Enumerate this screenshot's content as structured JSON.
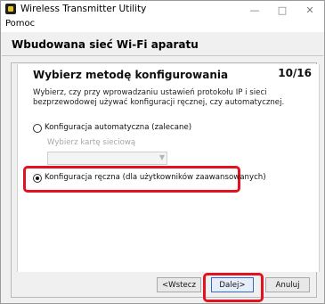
{
  "window": {
    "title": "Wireless Transmitter Utility"
  },
  "titlebar_controls": {
    "minimize": "—",
    "maximize": "□",
    "close": "✕"
  },
  "menu": {
    "items": [
      "Pomoc"
    ]
  },
  "section": {
    "title": "Wbudowana sieć Wi-Fi aparatu"
  },
  "step": {
    "heading": "Wybierz metodę konfigurowania",
    "counter": "10/16",
    "instruction": "Wybierz, czy przy wprowadzaniu ustawień protokołu IP i sieci bezprzewodowej używać konfiguracji ręcznej, czy automatycznej."
  },
  "options": {
    "auto_label": "Konfiguracja automatyczna (zalecane)",
    "adapter_label": "Wybierz kartę sieciową",
    "manual_label": "Konfiguracja ręczna (dla użytkowników zaawansowanych)",
    "selected": "manual"
  },
  "buttons": {
    "back": "<Wstecz",
    "next": "Dalej>",
    "cancel": "Anuluj"
  },
  "colors": {
    "highlight": "#e2121f"
  }
}
